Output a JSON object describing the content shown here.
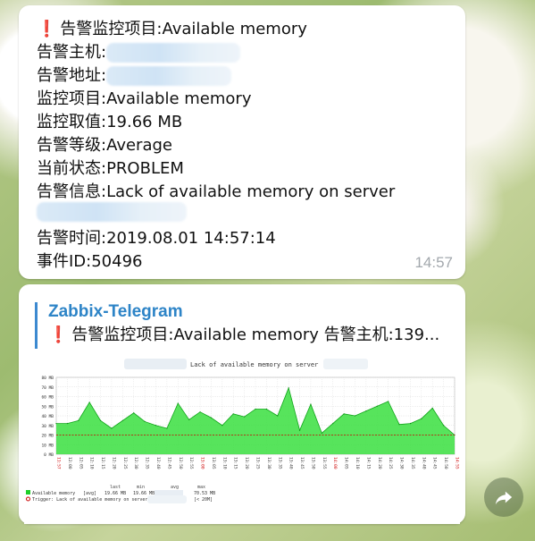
{
  "message1": {
    "title": "告警监控项目:Available memory",
    "host_label": "告警主机:",
    "address_label": "告警地址:",
    "item": "监控项目:Available memory",
    "value": "监控取值:19.66 MB",
    "severity": "告警等级:Average",
    "status": "当前状态:PROBLEM",
    "info": "告警信息:Lack of available memory on server",
    "time": "告警时间:2019.08.01 14:57:14",
    "event_id": "事件ID:50496",
    "sent_time": "14:57"
  },
  "message2": {
    "preview_title": "Zabbix-Telegram",
    "preview_text": "告警监控项目:Available memory 告警主机:139..."
  },
  "colors": {
    "accent": "#2d84c7",
    "alert": "#e0242b",
    "series": "#1fcf2a",
    "trigger": "#cc0000"
  },
  "chart_data": {
    "type": "area",
    "title": "Lack of available memory on server",
    "ylabel": "",
    "ylim": [
      0,
      80
    ],
    "y_ticks": [
      "0 MB",
      "10 MB",
      "20 MB",
      "30 MB",
      "40 MB",
      "50 MB",
      "60 MB",
      "70 MB",
      "80 MB"
    ],
    "x_ticks": [
      "11:57",
      "12:00",
      "12:05",
      "12:10",
      "12:15",
      "12:20",
      "12:25",
      "12:30",
      "12:35",
      "12:40",
      "12:45",
      "12:50",
      "12:55",
      "13:00",
      "13:05",
      "13:10",
      "13:15",
      "13:20",
      "13:25",
      "13:30",
      "13:35",
      "13:40",
      "13:45",
      "13:50",
      "13:55",
      "14:00",
      "14:05",
      "14:10",
      "14:15",
      "14:20",
      "14:25",
      "14:30",
      "14:35",
      "14:40",
      "14:45",
      "14:50",
      "14:55"
    ],
    "series": [
      {
        "name": "Available memory",
        "values": [
          32,
          32,
          35,
          54,
          35,
          27,
          35,
          43,
          34,
          30,
          27,
          53,
          36,
          44,
          38,
          30,
          42,
          39,
          47,
          47,
          40,
          69,
          25,
          52,
          22,
          32,
          42,
          40,
          45,
          50,
          55,
          31,
          32,
          37,
          48,
          30,
          20
        ]
      }
    ],
    "trigger_level": 20,
    "legend": [
      {
        "label": "Available memory",
        "type": "[avg]",
        "last": "19.66 MB",
        "min": "19.66 MB",
        "avg": "",
        "max": "70.53 MB"
      },
      {
        "label": "Trigger: Lack of available memory on server",
        "threshold": "[< 20M]"
      }
    ],
    "legend_headers": [
      "last",
      "min",
      "avg",
      "max"
    ]
  }
}
